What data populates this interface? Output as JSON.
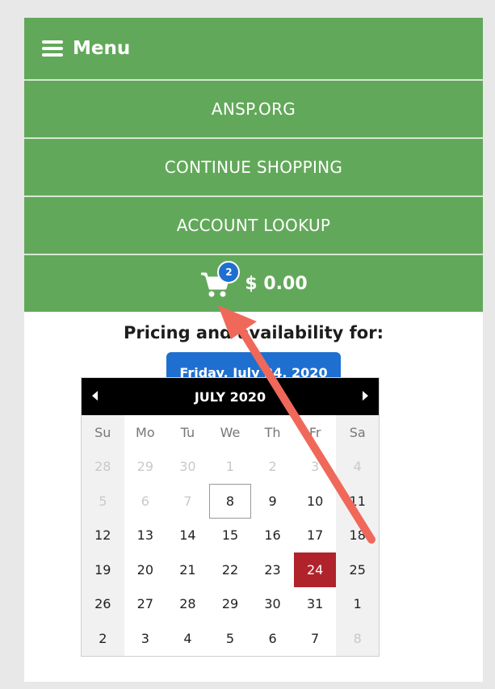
{
  "header": {
    "menu_label": "Menu"
  },
  "nav": {
    "items": [
      "ANSP.ORG",
      "CONTINUE SHOPPING",
      "ACCOUNT LOOKUP"
    ]
  },
  "cart": {
    "count": "2",
    "total": "$ 0.00"
  },
  "pricing": {
    "label": "Pricing and availability for:",
    "selected_date": "Friday, July 24, 2020"
  },
  "calendar": {
    "month_label": "JULY 2020",
    "days_of_week": [
      "Su",
      "Mo",
      "Tu",
      "We",
      "Th",
      "Fr",
      "Sa"
    ],
    "weeks": [
      [
        "28",
        "29",
        "30",
        "1",
        "2",
        "3",
        "4"
      ],
      [
        "5",
        "6",
        "7",
        "8",
        "9",
        "10",
        "11"
      ],
      [
        "12",
        "13",
        "14",
        "15",
        "16",
        "17",
        "18"
      ],
      [
        "19",
        "20",
        "21",
        "22",
        "23",
        "24",
        "25"
      ],
      [
        "26",
        "27",
        "28",
        "29",
        "30",
        "31",
        "1"
      ],
      [
        "2",
        "3",
        "4",
        "5",
        "6",
        "7",
        "8"
      ]
    ],
    "selected_day": "24",
    "today_day": "8"
  },
  "colors": {
    "nav_green": "#62a85a",
    "button_blue": "#1f6fd1",
    "selected_red": "#b0232a",
    "annotation_arrow": "#f0685a"
  },
  "icons": {
    "menu": "hamburger-icon",
    "cart": "shopping-cart-icon",
    "prev": "chevron-left-icon",
    "next": "chevron-right-icon"
  }
}
